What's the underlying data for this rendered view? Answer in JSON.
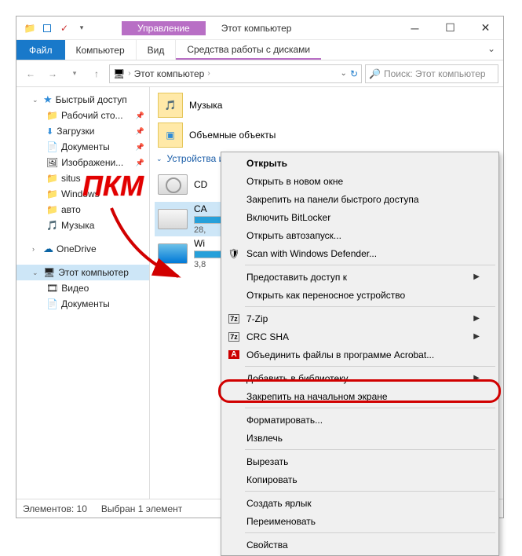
{
  "titlebar": {
    "context_tab": "Управление",
    "window_title": "Этот компьютер"
  },
  "ribbon": {
    "file": "Файл",
    "tabs": [
      "Компьютер",
      "Вид"
    ],
    "context": "Средства работы с дисками"
  },
  "address": {
    "root": "Этот компьютер",
    "search_placeholder": "Поиск: Этот компьютер"
  },
  "tree": {
    "quick": "Быстрый доступ",
    "quick_items": [
      "Рабочий сто...",
      "Загрузки",
      "Документы",
      "Изображени...",
      "situs",
      "Windows",
      "авто",
      "Музыка"
    ],
    "onedrive": "OneDrive",
    "this_pc": "Этот компьютер",
    "this_pc_items": [
      "Видео",
      "Документы"
    ]
  },
  "content": {
    "folders": [
      {
        "name": "Музыка"
      },
      {
        "name": "Объемные объекты"
      }
    ],
    "devices_header": "Устройства и",
    "drives": [
      {
        "name": "CD",
        "type": "cd"
      },
      {
        "name": "CA",
        "size": "28,",
        "type": "hdd",
        "fill": 55
      },
      {
        "name": "Wi",
        "size": "3,8",
        "type": "win",
        "fill": 85
      }
    ]
  },
  "status": {
    "count": "Элементов: 10",
    "selection": "Выбран 1 элемент"
  },
  "context_menu": {
    "open": "Открыть",
    "open_new": "Открыть в новом окне",
    "pin_quick": "Закрепить на панели быстрого доступа",
    "bitlocker": "Включить BitLocker",
    "autoplay": "Открыть автозапуск...",
    "defender": "Scan with Windows Defender...",
    "access": "Предоставить доступ к",
    "portable": "Открыть как переносное устройство",
    "sevenzip": "7-Zip",
    "crc": "CRC SHA",
    "acrobat": "Объединить файлы в программе Acrobat...",
    "library": "Добавить в библиотеку",
    "pin_start": "Закрепить на начальном экране",
    "format": "Форматировать...",
    "eject": "Извлечь",
    "cut": "Вырезать",
    "copy": "Копировать",
    "shortcut": "Создать ярлык",
    "rename": "Переименовать",
    "properties": "Свойства"
  },
  "annotation": {
    "label": "ПКМ"
  }
}
